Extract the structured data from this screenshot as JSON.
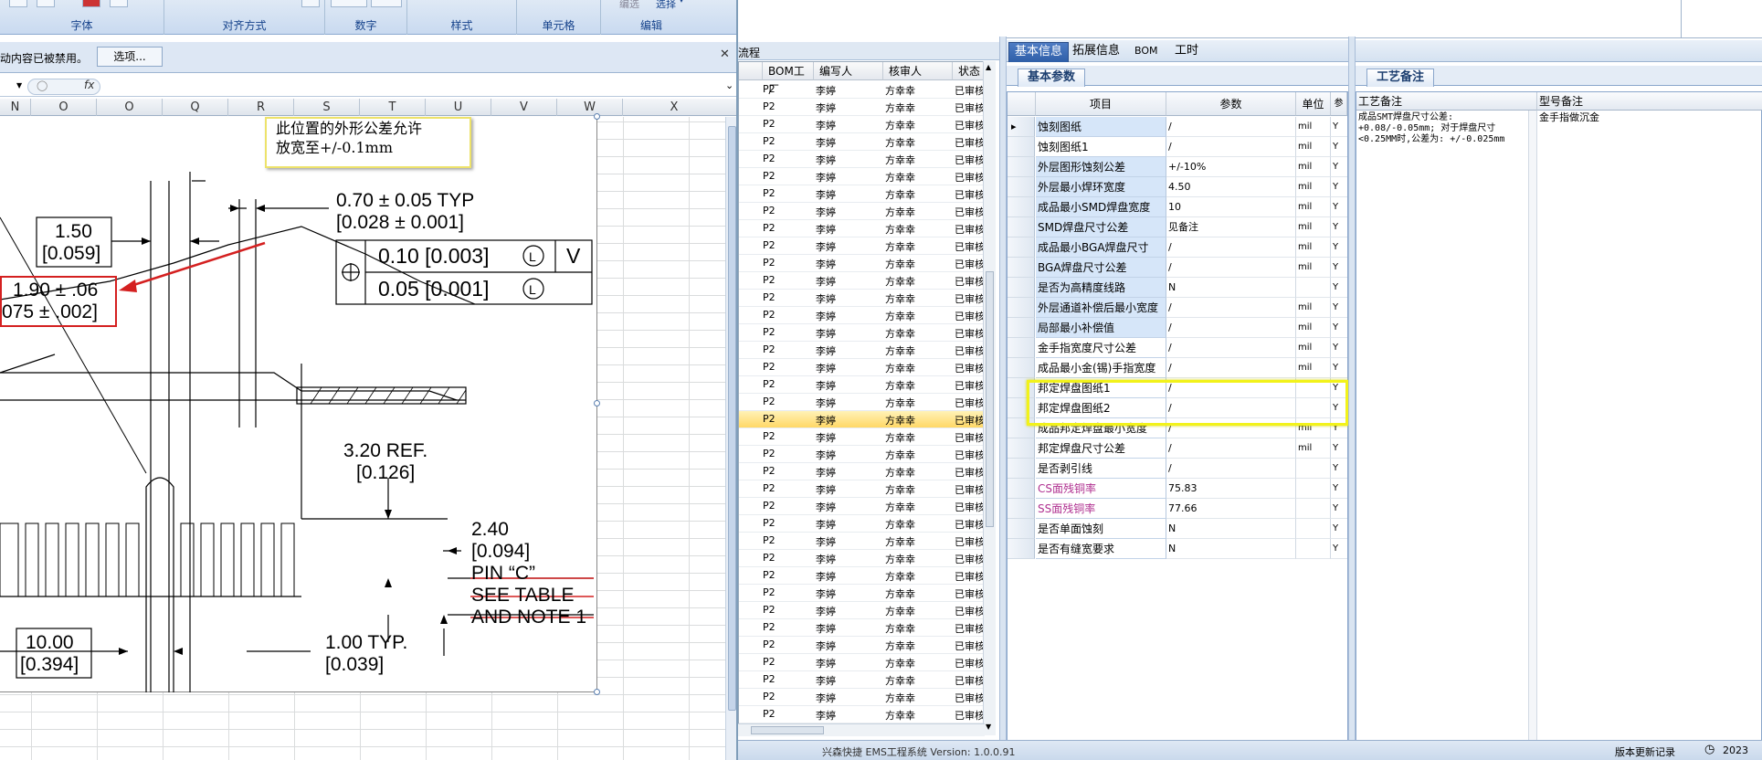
{
  "excel": {
    "ribbon_groups": [
      "字体",
      "对齐方式",
      "数字",
      "样式",
      "单元格",
      "编辑"
    ],
    "edit_select_label": "选择",
    "edit_sort_label": "编选",
    "security_message": "动内容已被禁用。",
    "options_button": "选项...",
    "columns": [
      "N",
      "O",
      "P",
      "Q",
      "R",
      "S",
      "T",
      "U",
      "V",
      "W",
      "X"
    ],
    "drawing": {
      "callout_lines": [
        "此位置的外形公差允许",
        "放宽至+/-0.1mm"
      ],
      "dim_redbox": [
        "1.90 ± .06",
        "075 ± .002]"
      ],
      "dim_070": [
        "0.70 ± 0.05 TYP",
        "[0.028 ± 0.001]"
      ],
      "dim_150": [
        "1.50",
        "[0.059]"
      ],
      "fcf_row1": "0.10 [0.003]",
      "fcf_row2": "0.05 [0.001]",
      "fcf_L": "L",
      "fcf_V": "V",
      "dim_320": [
        "3.20 REF.",
        "[0.126]"
      ],
      "dim_240": [
        "2.40",
        "[0.094]"
      ],
      "pin_note": [
        "PIN “C”",
        "SEE TABLE",
        "AND NOTE 1"
      ],
      "dim_1000": [
        "10.00",
        "[0.394]"
      ],
      "dim_100": [
        "1.00 TYP.",
        "[0.039]"
      ]
    }
  },
  "middle": {
    "title": "流程",
    "headers": [
      "BOM工厂",
      "编写人",
      "核审人",
      "状态"
    ],
    "row_values": {
      "factory": "P2",
      "author": "李婷",
      "reviewer": "方幸幸",
      "status": "已审核"
    },
    "row_count": 38,
    "selected_row_index": 19
  },
  "right": {
    "tabs": [
      "基本信息",
      "拓展信息",
      "BOM",
      "工时"
    ],
    "subtab_params": "基本参数",
    "subtab_notes": "工艺备注",
    "param_headers": [
      "项目",
      "参数",
      "单位",
      "参"
    ],
    "params": [
      {
        "name": "蚀刻图纸",
        "value": "/",
        "unit": "mil",
        "flag": "Y"
      },
      {
        "name": "蚀刻图纸1",
        "value": "/",
        "unit": "mil",
        "flag": "Y"
      },
      {
        "name": "外层图形蚀刻公差",
        "value": "+/-10%",
        "unit": "mil",
        "flag": "Y"
      },
      {
        "name": "外层最小焊环宽度",
        "value": "4.50",
        "unit": "mil",
        "flag": "Y"
      },
      {
        "name": "成品最小SMD焊盘宽度",
        "value": "10",
        "unit": "mil",
        "flag": "Y"
      },
      {
        "name": "SMD焊盘尺寸公差",
        "value": "见备注",
        "unit": "mil",
        "flag": "Y"
      },
      {
        "name": "成品最小BGA焊盘尺寸",
        "value": "/",
        "unit": "mil",
        "flag": "Y"
      },
      {
        "name": "BGA焊盘尺寸公差",
        "value": "/",
        "unit": "mil",
        "flag": "Y"
      },
      {
        "name": "是否为高精度线路",
        "value": "N",
        "unit": "",
        "flag": "Y"
      },
      {
        "name": "外层通道补偿后最小宽度",
        "value": "/",
        "unit": "mil",
        "flag": "Y"
      },
      {
        "name": "局部最小补偿值",
        "value": "/",
        "unit": "mil",
        "flag": "Y"
      },
      {
        "name": "金手指宽度尺寸公差",
        "value": "/",
        "unit": "mil",
        "flag": "Y"
      },
      {
        "name": "成品最小金(锡)手指宽度",
        "value": "/",
        "unit": "mil",
        "flag": "Y"
      },
      {
        "name": "邦定焊盘图纸1",
        "value": "/",
        "unit": "",
        "flag": "Y"
      },
      {
        "name": "邦定焊盘图纸2",
        "value": "/",
        "unit": "",
        "flag": "Y"
      },
      {
        "name": "成品邦定焊盘最小宽度",
        "value": "/",
        "unit": "mil",
        "flag": "Y"
      },
      {
        "name": "邦定焊盘尺寸公差",
        "value": "/",
        "unit": "mil",
        "flag": "Y"
      },
      {
        "name": "是否剥引线",
        "value": "/",
        "unit": "",
        "flag": "Y"
      },
      {
        "name": "CS面残铜率",
        "value": "75.83",
        "unit": "",
        "flag": "Y"
      },
      {
        "name": "SS面残铜率",
        "value": "77.66",
        "unit": "",
        "flag": "Y"
      },
      {
        "name": "是否单面蚀刻",
        "value": "N",
        "unit": "",
        "flag": "Y"
      },
      {
        "name": "是否有缝宽要求",
        "value": "N",
        "unit": "",
        "flag": "Y"
      }
    ],
    "notes_headers": [
      "工艺备注",
      "型号备注"
    ],
    "process_note": "成品SMT焊盘尺寸公差: +0.08/-0.05mm; 对于焊盘尺寸<0.25MM时,公差为: +/-0.025mm",
    "model_note": "金手指做沉金"
  },
  "status": {
    "app_text": "兴森快捷 EMS工程系统 Version: 1.0.0.91",
    "update_record": "版本更新记录",
    "year_text": "2023"
  }
}
